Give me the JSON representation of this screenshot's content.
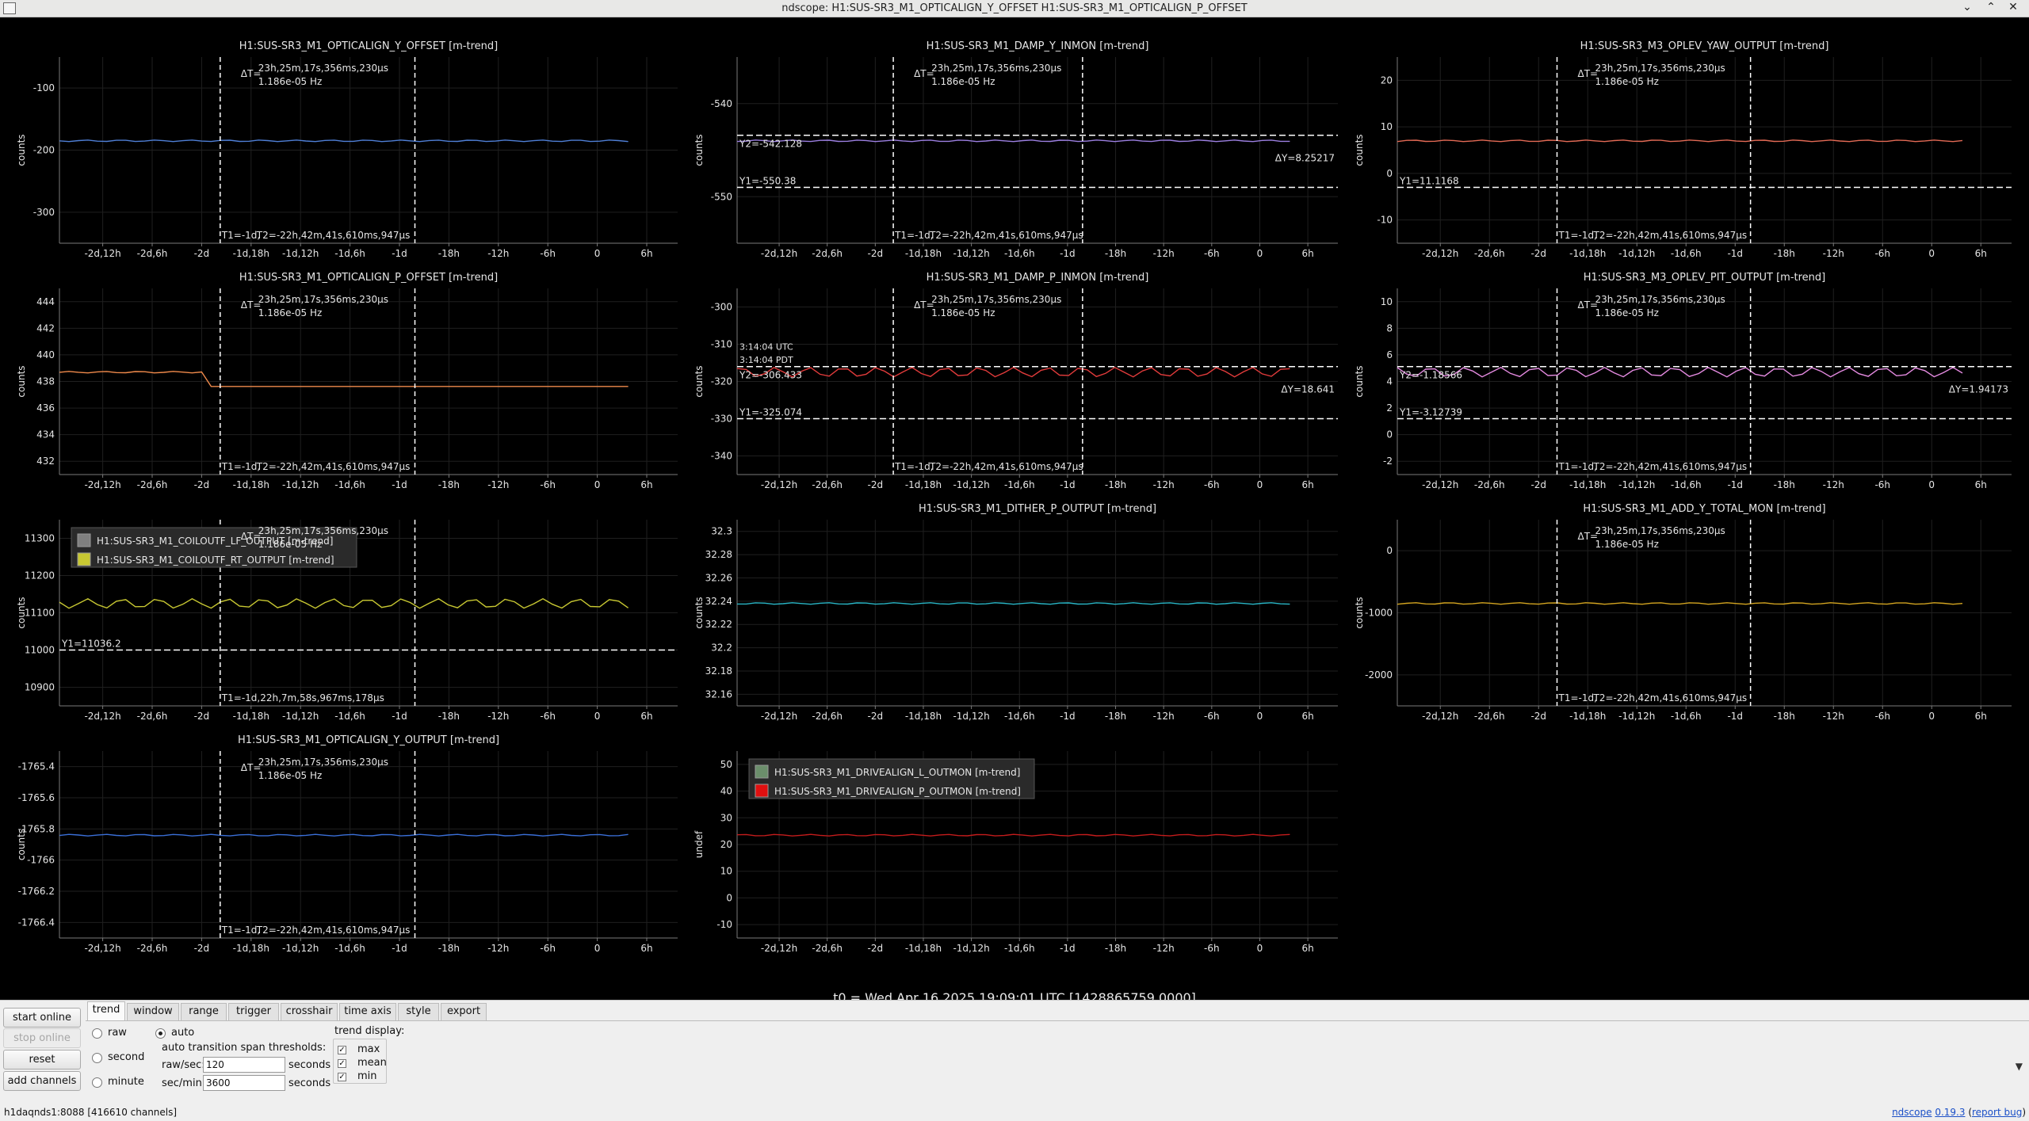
{
  "window": {
    "title": "ndscope: H1:SUS-SR3_M1_OPTICALIGN_Y_OFFSET H1:SUS-SR3_M1_OPTICALIGN_P_OFFSET"
  },
  "colors": {
    "bg": "#000000",
    "grid": "#1f1f1f",
    "axis": "#7a7a7a",
    "text": "#e6e6e6",
    "cursor": "#ffffff"
  },
  "time_ticks": [
    "-2d,12h",
    "-2d,6h",
    "-2d",
    "-1d,18h",
    "-1d,12h",
    "-1d,6h",
    "-1d",
    "-18h",
    "-12h",
    "-6h",
    "0",
    "6h"
  ],
  "cursor_labels": {
    "dT": "ΔT=",
    "dT_time": "23h,25m,17s,356ms,230μs",
    "dT_freq": "1.186e-05 Hz",
    "t1": "T1=-1d,",
    "t2": "T2=-22h,42m,41s,610ms,947μs",
    "t1_coil": "T1=-1d,22h,7m,58s,967ms,178μs"
  },
  "plots": [
    {
      "title": "H1:SUS-SR3_M1_OPTICALIGN_Y_OFFSET [m-trend]",
      "ylabel": "counts",
      "yticks": [
        "-100",
        "-200",
        "-300"
      ]
    },
    {
      "title": "H1:SUS-SR3_M1_DAMP_Y_INMON [m-trend]",
      "ylabel": "counts",
      "yticks": [
        "-540",
        "-550"
      ],
      "y2": "Y2=-542.128",
      "y1": "Y1=-550.38",
      "dy": "ΔY=8.25217"
    },
    {
      "title": "H1:SUS-SR3_M3_OPLEV_YAW_OUTPUT [m-trend]",
      "ylabel": "counts",
      "yticks": [
        "20",
        "10",
        "0",
        "-10"
      ],
      "y1": "Y1=11.1168"
    },
    {
      "title": "H1:SUS-SR3_M1_OPTICALIGN_P_OFFSET [m-trend]",
      "ylabel": "counts",
      "yticks": [
        "444",
        "442",
        "440",
        "438",
        "436",
        "434",
        "432"
      ]
    },
    {
      "title": "H1:SUS-SR3_M1_DAMP_P_INMON [m-trend]",
      "ylabel": "counts",
      "yticks": [
        "-300",
        "-310",
        "-320",
        "-330",
        "-340"
      ],
      "y2": "Y2=-306.433",
      "y1": "Y1=-325.074",
      "dy": "ΔY=18.641",
      "hover1": "3:14:04 UTC",
      "hover2": "3:14:04 PDT"
    },
    {
      "title": "H1:SUS-SR3_M3_OPLEV_PIT_OUTPUT [m-trend]",
      "ylabel": "counts",
      "yticks": [
        "10",
        "8",
        "6",
        "4",
        "2",
        "0",
        "-2"
      ],
      "y2": "Y2=-1.18566",
      "y1": "Y1=-3.12739",
      "dy": "ΔY=1.94173"
    },
    {
      "title": "",
      "ylabel": "counts",
      "yticks": [
        "11300",
        "11200",
        "11100",
        "11000",
        "10900"
      ],
      "y1": "Y1=11036.2",
      "legend": [
        "H1:SUS-SR3_M1_COILOUTF_LF_OUTPUT [m-trend]",
        "H1:SUS-SR3_M1_COILOUTF_RT_OUTPUT [m-trend]"
      ]
    },
    {
      "title": "H1:SUS-SR3_M1_DITHER_P_OUTPUT [m-trend]",
      "ylabel": "counts",
      "yticks": [
        "32.3",
        "32.28",
        "32.26",
        "32.24",
        "32.22",
        "32.2",
        "32.18",
        "32.16"
      ]
    },
    {
      "title": "H1:SUS-SR3_M1_ADD_Y_TOTAL_MON [m-trend]",
      "ylabel": "counts",
      "yticks": [
        "0",
        "-1000",
        "-2000"
      ]
    },
    {
      "title": "H1:SUS-SR3_M1_OPTICALIGN_Y_OUTPUT [m-trend]",
      "ylabel": "counts",
      "yticks": [
        "-1765.4",
        "-1765.6",
        "-1765.8",
        "-1766",
        "-1766.2",
        "-1766.4"
      ]
    },
    {
      "title": "",
      "ylabel": "undef",
      "yticks": [
        "50",
        "40",
        "30",
        "20",
        "10",
        "0",
        "-10"
      ],
      "legend": [
        "H1:SUS-SR3_M1_DRIVEALIGN_L_OUTMON [m-trend]",
        "H1:SUS-SR3_M1_DRIVEALIGN_P_OUTMON [m-trend]"
      ]
    }
  ],
  "t0": "t0 = Wed Apr 16 2025 19:09:01 UTC [1428865759.0000]",
  "controls": {
    "start_online": "start online",
    "stop_online": "stop online",
    "reset": "reset",
    "add_channels": "add channels",
    "tabs": [
      "trend",
      "window",
      "range",
      "trigger",
      "crosshair",
      "time axis",
      "style",
      "export"
    ],
    "radio_raw": "raw",
    "radio_second": "second",
    "radio_minute": "minute",
    "radio_auto": "auto",
    "thresholds_label": "auto transition span thresholds:",
    "raw_sec_label": "raw/sec:",
    "raw_sec_value": "120",
    "sec_min_label": "sec/min:",
    "sec_min_value": "3600",
    "seconds": "seconds",
    "trend_display": "trend display:",
    "chk_max": "max",
    "chk_mean": "mean",
    "chk_min": "min"
  },
  "status": "h1daqnds1:8088  [416610 channels]",
  "version": {
    "name": "ndscope",
    "number": "0.19.3",
    "report": "report bug"
  }
}
